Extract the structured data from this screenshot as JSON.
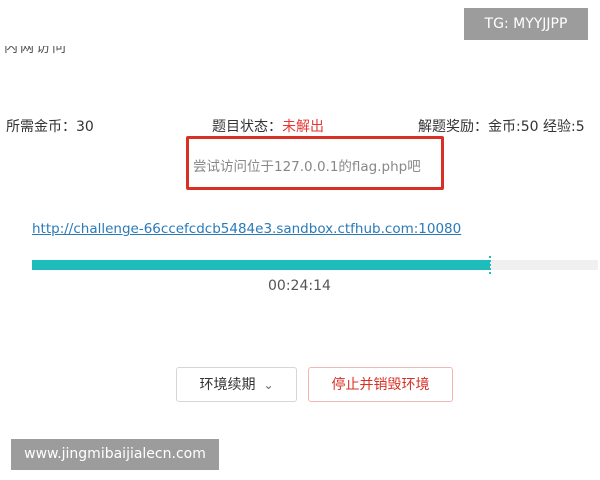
{
  "header": {
    "partial_title": "内网访问"
  },
  "badge": {
    "tg": "TG: MYYJJPP"
  },
  "info": {
    "cost": "所需金币：30",
    "status_label": "题目状态：",
    "status_value": "未解出",
    "reward": "解题奖励：金币:50 经验:5"
  },
  "hint": {
    "text": "尝试访问位于127.0.0.1的flag.php吧"
  },
  "env": {
    "url": "http://challenge-66ccefcdcb5484e3.sandbox.ctfhub.com:10080",
    "progress": 0.81,
    "timer": "00:24:14"
  },
  "buttons": {
    "renew": "环境续期",
    "renew_icon": "chevron-down-icon",
    "stop": "停止并销毁环境"
  },
  "watermark": {
    "text": "www.jingmibaijialecn.com"
  },
  "colors": {
    "status_red": "#e53935",
    "accent_teal": "#1fbcbc",
    "link_blue": "#2a7ab8",
    "hint_border": "#d93025"
  }
}
